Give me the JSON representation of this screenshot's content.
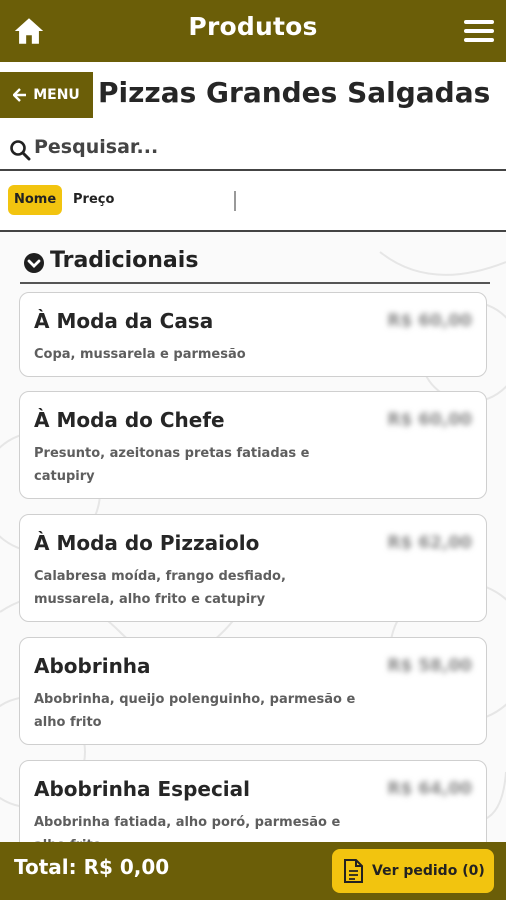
{
  "header": {
    "title": "Produtos",
    "home_icon": "home-icon",
    "menu_icon": "hamburger-icon"
  },
  "subheader": {
    "back_label": "MENU",
    "page_title": "Pizzas Grandes Salgadas"
  },
  "search": {
    "placeholder": "Pesquisar..."
  },
  "sort": {
    "options": [
      "Nome",
      "Preço"
    ],
    "active": "Nome"
  },
  "section": {
    "title": "Tradicionais"
  },
  "products": [
    {
      "name": "À Moda da Casa",
      "desc": "Copa, mussarela e parmesão",
      "price": "R$ 60,00"
    },
    {
      "name": "À Moda do Chefe",
      "desc": "Presunto, azeitonas pretas fatiadas e catupiry",
      "price": "R$ 60,00"
    },
    {
      "name": "À Moda do Pizzaiolo",
      "desc": "Calabresa moída, frango desfiado, mussarela, alho frito e catupiry",
      "price": "R$ 62,00"
    },
    {
      "name": "Abobrinha",
      "desc": "Abobrinha, queijo polenguinho, parmesão e alho frito",
      "price": "R$ 58,00"
    },
    {
      "name": "Abobrinha Especial",
      "desc": "Abobrinha fatiada, alho poró, parmesão e alho frito",
      "price": "R$ 64,00"
    }
  ],
  "footer": {
    "total": "Total: R$ 0,00",
    "order_button": "Ver pedido (0)"
  },
  "colors": {
    "brand": "#6b5e08",
    "accent": "#f2c40f"
  }
}
